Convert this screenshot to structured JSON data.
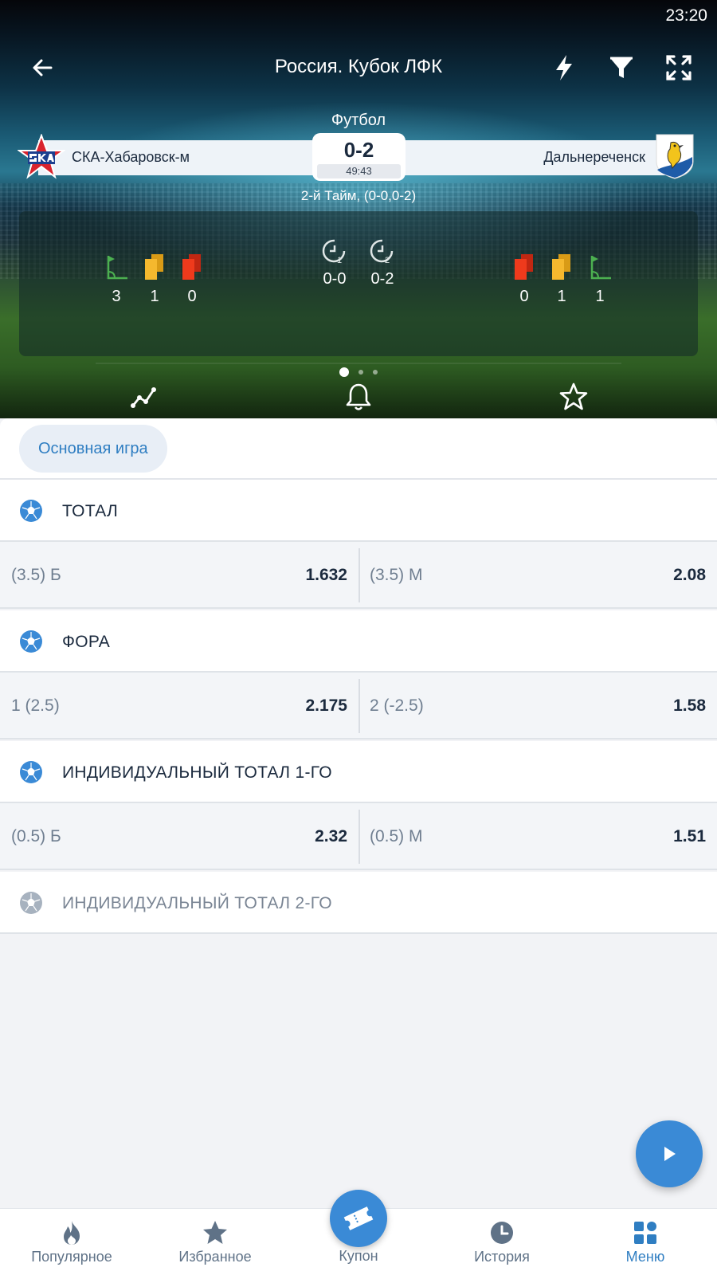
{
  "status_bar": {
    "time": "23:20"
  },
  "header": {
    "title": "Россия. Кубок ЛФК"
  },
  "match": {
    "sport": "Футбол",
    "home_team": "СКА-Хабаровск-м",
    "away_team": "Дальнереченск",
    "score": "0-2",
    "clock": "49:43",
    "period": "2-й Тайм, (0-0,0-2)"
  },
  "stats": {
    "home": {
      "corners": "3",
      "yellow_cards": "1",
      "red_cards": "0"
    },
    "away": {
      "red_cards": "0",
      "yellow_cards": "1",
      "corners": "1"
    },
    "halves": {
      "first_half": "0-0",
      "second_half": "0-2",
      "first_marker": "1",
      "second_marker": "2"
    }
  },
  "tabs": {
    "main_game": "Основная игра"
  },
  "markets": [
    {
      "title": "ТОТАЛ",
      "left_label": "(3.5) Б",
      "left_value": "1.632",
      "right_label": "(3.5) М",
      "right_value": "2.08"
    },
    {
      "title": "ФОРА",
      "left_label": "1 (2.5)",
      "left_value": "2.175",
      "right_label": "2 (-2.5)",
      "right_value": "1.58"
    },
    {
      "title": "ИНДИВИДУАЛЬНЫЙ ТОТАЛ 1-ГО",
      "left_label": "(0.5) Б",
      "left_value": "2.32",
      "right_label": "(0.5) М",
      "right_value": "1.51"
    },
    {
      "title": "ИНДИВИДУАЛЬНЫЙ ТОТАЛ 2-ГО"
    }
  ],
  "bottom_nav": {
    "popular": "Популярное",
    "favorites": "Избранное",
    "coupon": "Купон",
    "history": "История",
    "menu": "Меню"
  },
  "colors": {
    "accent": "#3a8ad6",
    "active_nav": "#2f7ec2",
    "yellow_card": "#f5b82e",
    "red_card": "#ee3a1c",
    "corner_flag": "#4cb050"
  }
}
